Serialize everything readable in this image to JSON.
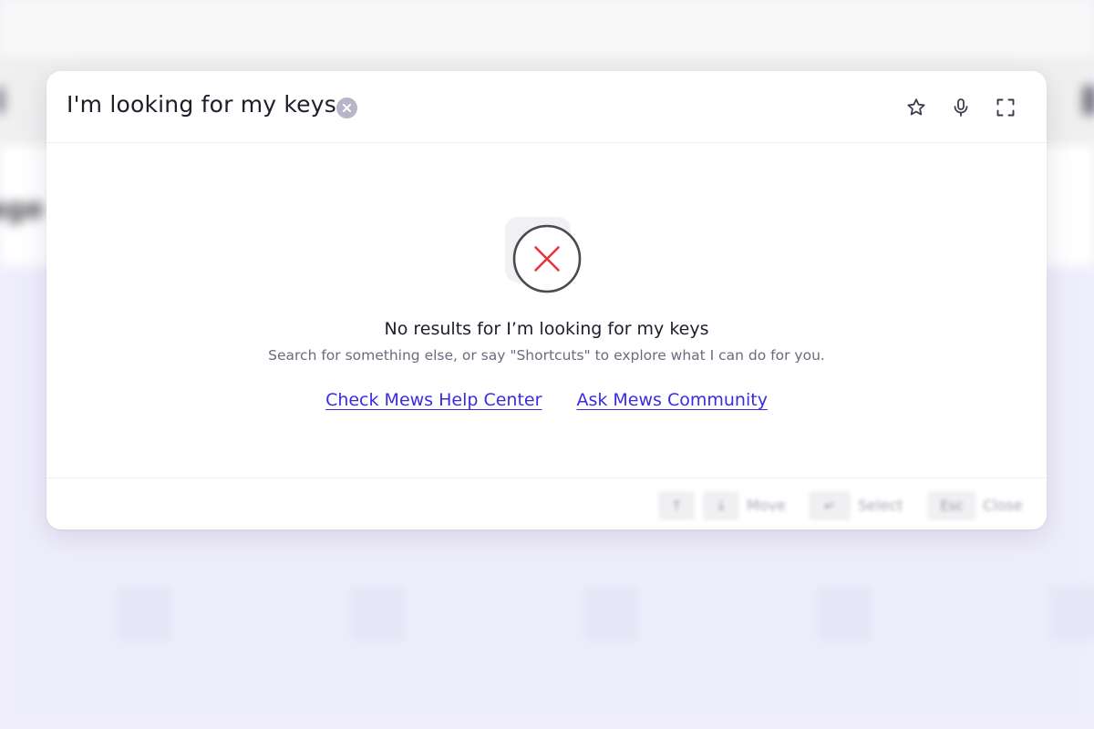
{
  "background": {
    "page_heading_fragment": "age"
  },
  "search": {
    "query": "I'm looking for my keys",
    "clear_icon": "close-circle-icon",
    "actions": [
      {
        "name": "favorite",
        "icon": "star-icon"
      },
      {
        "name": "voice",
        "icon": "microphone-icon"
      },
      {
        "name": "fullscreen",
        "icon": "expand-icon"
      }
    ]
  },
  "empty_state": {
    "icon": "no-results-x-icon",
    "title": "No results for I’m looking for my keys",
    "subtitle": "Search for something else, or say \"Shortcuts\" to explore what I can do for you.",
    "links": {
      "help_center": "Check Mews Help Center",
      "community": "Ask Mews Community"
    }
  },
  "footer": {
    "up_key": "↑",
    "down_key": "↓",
    "move_label": "Move",
    "enter_key": "↵",
    "select_label": "Select",
    "esc_key": "Esc",
    "close_label": "Close"
  },
  "colors": {
    "accent": "#3b2be0",
    "error": "#e8333a",
    "background": "#eeedfb"
  }
}
